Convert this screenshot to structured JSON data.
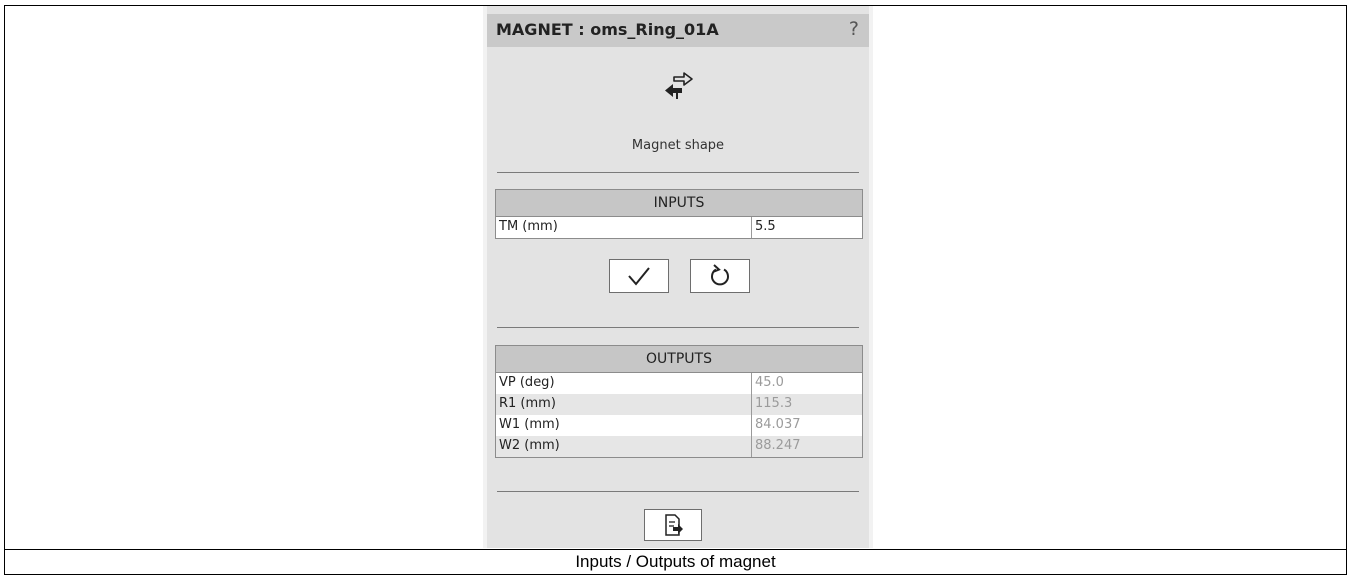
{
  "panel": {
    "title": "MAGNET : oms_Ring_01A",
    "help": "?",
    "shape_button_label": "Magnet shape"
  },
  "inputs": {
    "header": "INPUTS",
    "rows": [
      {
        "label": "TM (mm)",
        "value": "5.5"
      }
    ]
  },
  "actions": {
    "validate_icon": "checkmark-icon",
    "reset_icon": "refresh-icon",
    "export_icon": "export-icon"
  },
  "outputs": {
    "header": "OUTPUTS",
    "rows": [
      {
        "label": "VP (deg)",
        "value": "45.0"
      },
      {
        "label": "R1 (mm)",
        "value": "115.3"
      },
      {
        "label": "W1 (mm)",
        "value": "84.037"
      },
      {
        "label": "W2 (mm)",
        "value": "88.247"
      }
    ]
  },
  "caption": "Inputs / Outputs of magnet"
}
